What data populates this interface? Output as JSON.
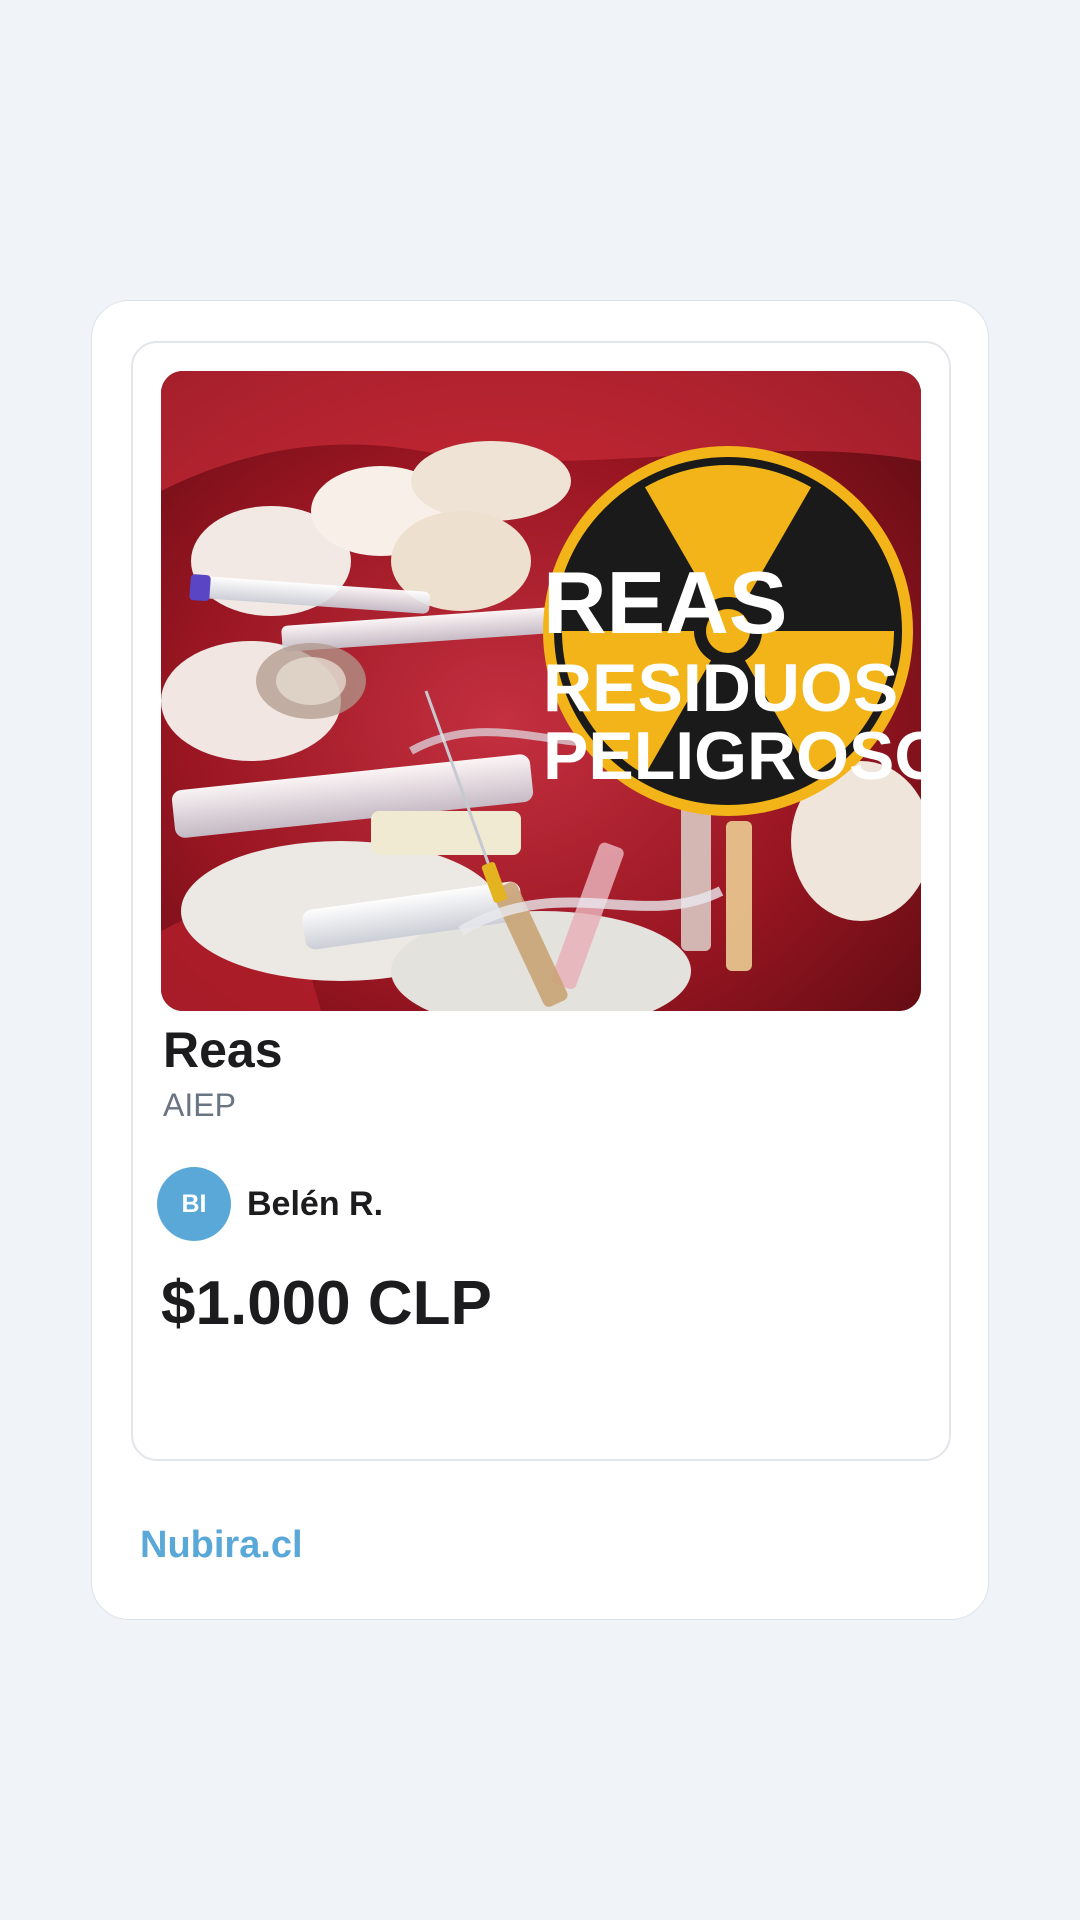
{
  "product": {
    "image_alt": "REAS RESIDUOS PELIGROSOS",
    "image_text": {
      "line1": "REAS",
      "line2": "RESIDUOS",
      "line3": "PELIGROSOS"
    },
    "title": "Reas",
    "subtitle": "AIEP",
    "seller": {
      "initials": "BI",
      "name": "Belén R."
    },
    "price": "$1.000 CLP"
  },
  "footer": {
    "brand": "Nubira.cl"
  },
  "colors": {
    "page_background": "#f0f4f8",
    "accent": "#5aa8d8",
    "text_primary": "#1c1c1e",
    "text_secondary": "#6b7482",
    "hazard_yellow": "#f2b418"
  }
}
